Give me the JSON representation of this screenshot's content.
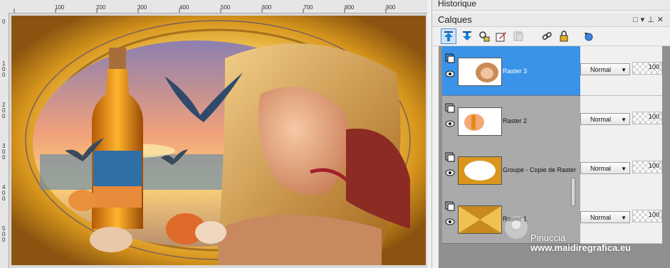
{
  "canvas": {
    "ruler_top_labels": [
      "100",
      "200",
      "300",
      "400",
      "500",
      "600",
      "700",
      "800",
      "900"
    ],
    "ruler_left_labels": [
      "0",
      "1 0 0",
      "2 0 0",
      "3 0 0",
      "4 0 0",
      "5 0 0"
    ]
  },
  "panels": {
    "history_title": "Historique",
    "layers_title": "Calques"
  },
  "layers": [
    {
      "name": "Raster 3",
      "blend_mode": "Normal",
      "opacity": "100",
      "selected": true,
      "thumb": "face"
    },
    {
      "name": "Raster 2",
      "blend_mode": "Normal",
      "opacity": "100",
      "selected": false,
      "thumb": "bottle"
    },
    {
      "name": "Groupe - Copie de Raster",
      "blend_mode": "Normal",
      "opacity": "100",
      "selected": false,
      "thumb": "frame"
    },
    {
      "name": "Raster 1",
      "blend_mode": "Normal",
      "opacity": "100",
      "selected": false,
      "thumb": "gold"
    }
  ],
  "watermark": {
    "name": "Pinuccia",
    "url": "www.maidiregrafica.eu"
  },
  "colors": {
    "selected_layer": "#3a93e8",
    "layer_bg": "#aaaaaa",
    "layers_area_bg": "#8f8f8f"
  }
}
